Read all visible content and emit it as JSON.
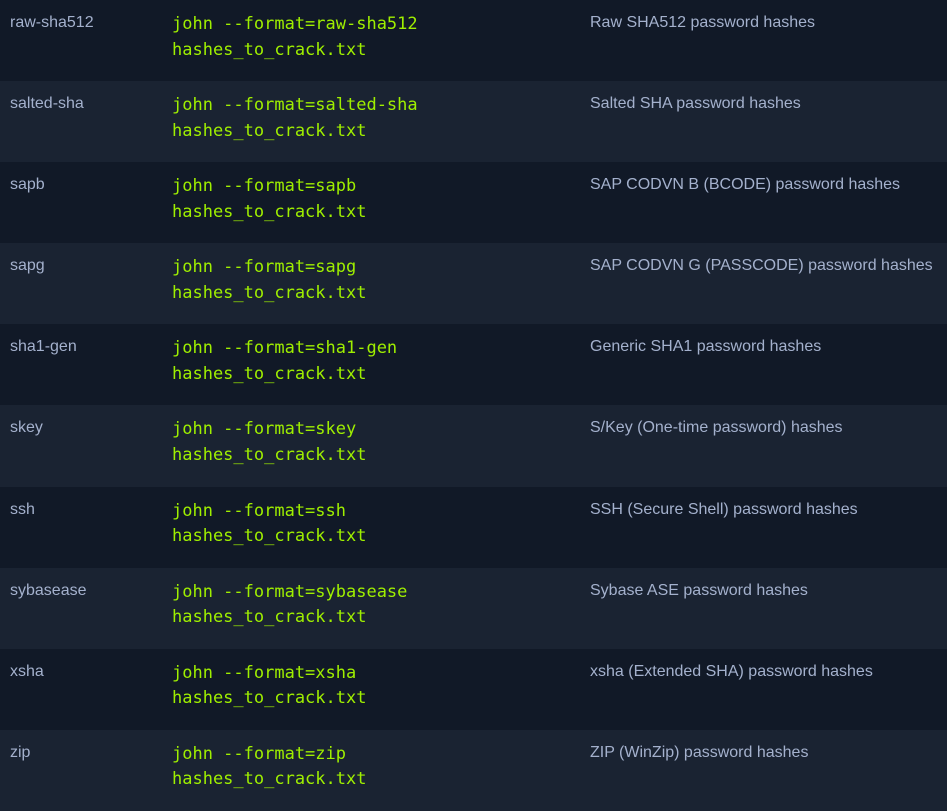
{
  "colors": {
    "row_dark": "#111927",
    "row_light": "#1a2332",
    "text": "#a4b1cd",
    "command": "#9fef00"
  },
  "rows": [
    {
      "format": "raw-sha512",
      "cmd_line1": "john --format=raw-sha512",
      "cmd_line2": "hashes_to_crack.txt",
      "description": "Raw SHA512 password hashes"
    },
    {
      "format": "salted-sha",
      "cmd_line1": "john --format=salted-sha",
      "cmd_line2": "hashes_to_crack.txt",
      "description": "Salted SHA password hashes"
    },
    {
      "format": "sapb",
      "cmd_line1": "john --format=sapb",
      "cmd_line2": "hashes_to_crack.txt",
      "description": "SAP CODVN B (BCODE) password hashes"
    },
    {
      "format": "sapg",
      "cmd_line1": "john --format=sapg",
      "cmd_line2": "hashes_to_crack.txt",
      "description": "SAP CODVN G (PASSCODE) password hashes"
    },
    {
      "format": "sha1-gen",
      "cmd_line1": "john --format=sha1-gen",
      "cmd_line2": "hashes_to_crack.txt",
      "description": "Generic SHA1 password hashes"
    },
    {
      "format": "skey",
      "cmd_line1": "john --format=skey",
      "cmd_line2": "hashes_to_crack.txt",
      "description": "S/Key (One-time password) hashes"
    },
    {
      "format": "ssh",
      "cmd_line1": "john --format=ssh",
      "cmd_line2": "hashes_to_crack.txt",
      "description": "SSH (Secure Shell) password hashes"
    },
    {
      "format": "sybasease",
      "cmd_line1": "john --format=sybasease",
      "cmd_line2": "hashes_to_crack.txt",
      "description": "Sybase ASE password hashes"
    },
    {
      "format": "xsha",
      "cmd_line1": "john --format=xsha",
      "cmd_line2": "hashes_to_crack.txt",
      "description": "xsha (Extended SHA) password hashes"
    },
    {
      "format": "zip",
      "cmd_line1": "john --format=zip",
      "cmd_line2": "hashes_to_crack.txt",
      "description": "ZIP (WinZip) password hashes"
    }
  ]
}
